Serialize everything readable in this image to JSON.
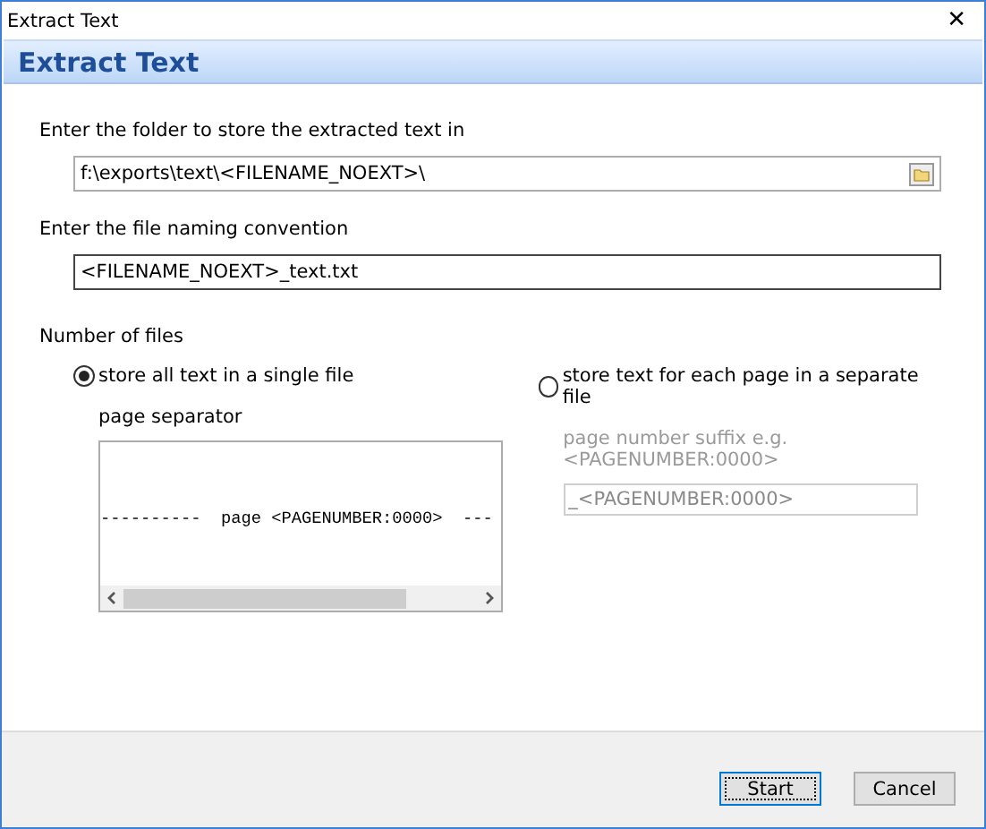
{
  "window": {
    "title": "Extract Text",
    "close": "✕"
  },
  "header": "Extract Text",
  "folder": {
    "label": "Enter the folder to store the extracted text in",
    "value": "f:\\exports\\text\\<FILENAME_NOEXT>\\"
  },
  "naming": {
    "label": "Enter the file naming convention",
    "value": "<FILENAME_NOEXT>_text.txt"
  },
  "number_of_files": {
    "label": "Number of files",
    "options": [
      {
        "label": "store all text in a single file",
        "selected": true,
        "sub_label": "page separator",
        "disabled": false,
        "kind": "textarea",
        "value": "----------  page <PAGENUMBER:0000>  ---"
      },
      {
        "label": "store text for each page in a separate file",
        "selected": false,
        "sub_label": "page number suffix e.g. <PAGENUMBER:0000>",
        "disabled": true,
        "kind": "input",
        "value": "_<PAGENUMBER:0000>"
      }
    ]
  },
  "buttons": [
    {
      "label": "Start",
      "default": true
    },
    {
      "label": "Cancel",
      "default": false
    }
  ]
}
